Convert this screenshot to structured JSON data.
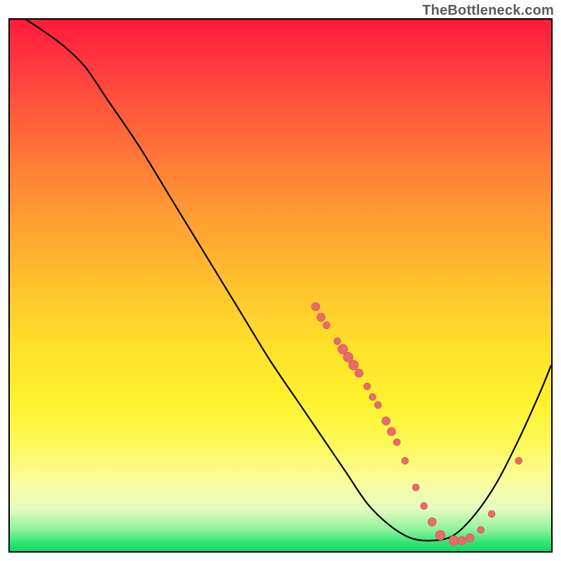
{
  "watermark": "TheBottleneck.com",
  "colors": {
    "curve_stroke": "#000000",
    "dot_fill": "#e86a6a",
    "dot_stroke": "#d05252"
  },
  "chart_data": {
    "type": "line",
    "title": "",
    "xlabel": "",
    "ylabel": "",
    "xlim": [
      0,
      100
    ],
    "ylim": [
      0,
      100
    ],
    "curve": [
      {
        "x": 3,
        "y": 100
      },
      {
        "x": 6,
        "y": 98
      },
      {
        "x": 10,
        "y": 95
      },
      {
        "x": 14,
        "y": 91
      },
      {
        "x": 18,
        "y": 85
      },
      {
        "x": 24,
        "y": 76
      },
      {
        "x": 30,
        "y": 66
      },
      {
        "x": 36,
        "y": 56
      },
      {
        "x": 42,
        "y": 46
      },
      {
        "x": 48,
        "y": 36
      },
      {
        "x": 54,
        "y": 27
      },
      {
        "x": 58,
        "y": 21
      },
      {
        "x": 62,
        "y": 15
      },
      {
        "x": 66,
        "y": 9
      },
      {
        "x": 70,
        "y": 5
      },
      {
        "x": 74,
        "y": 2.5
      },
      {
        "x": 78,
        "y": 2
      },
      {
        "x": 82,
        "y": 3
      },
      {
        "x": 86,
        "y": 7
      },
      {
        "x": 90,
        "y": 13
      },
      {
        "x": 94,
        "y": 21
      },
      {
        "x": 98,
        "y": 30
      },
      {
        "x": 100,
        "y": 35
      }
    ],
    "dots": [
      {
        "x": 56.5,
        "y": 46,
        "r": 6
      },
      {
        "x": 57.5,
        "y": 44,
        "r": 6
      },
      {
        "x": 58.5,
        "y": 42.5,
        "r": 5
      },
      {
        "x": 60.5,
        "y": 39.5,
        "r": 5
      },
      {
        "x": 61.5,
        "y": 38,
        "r": 7
      },
      {
        "x": 62.5,
        "y": 36.5,
        "r": 7
      },
      {
        "x": 63.5,
        "y": 35,
        "r": 7
      },
      {
        "x": 64.5,
        "y": 33.5,
        "r": 6
      },
      {
        "x": 66,
        "y": 31,
        "r": 5
      },
      {
        "x": 67,
        "y": 29,
        "r": 5
      },
      {
        "x": 68,
        "y": 27.5,
        "r": 5
      },
      {
        "x": 69.5,
        "y": 24.5,
        "r": 6
      },
      {
        "x": 70.5,
        "y": 22.5,
        "r": 6
      },
      {
        "x": 71.5,
        "y": 20.5,
        "r": 5
      },
      {
        "x": 73,
        "y": 17,
        "r": 5
      },
      {
        "x": 75,
        "y": 12,
        "r": 5
      },
      {
        "x": 76.5,
        "y": 8.5,
        "r": 5
      },
      {
        "x": 78,
        "y": 5.5,
        "r": 6
      },
      {
        "x": 79.5,
        "y": 3,
        "r": 7
      },
      {
        "x": 82,
        "y": 2,
        "r": 7
      },
      {
        "x": 83.5,
        "y": 2,
        "r": 6
      },
      {
        "x": 85,
        "y": 2.5,
        "r": 6
      },
      {
        "x": 87,
        "y": 4,
        "r": 5
      },
      {
        "x": 89,
        "y": 7,
        "r": 5
      },
      {
        "x": 94,
        "y": 17,
        "r": 5
      }
    ]
  }
}
